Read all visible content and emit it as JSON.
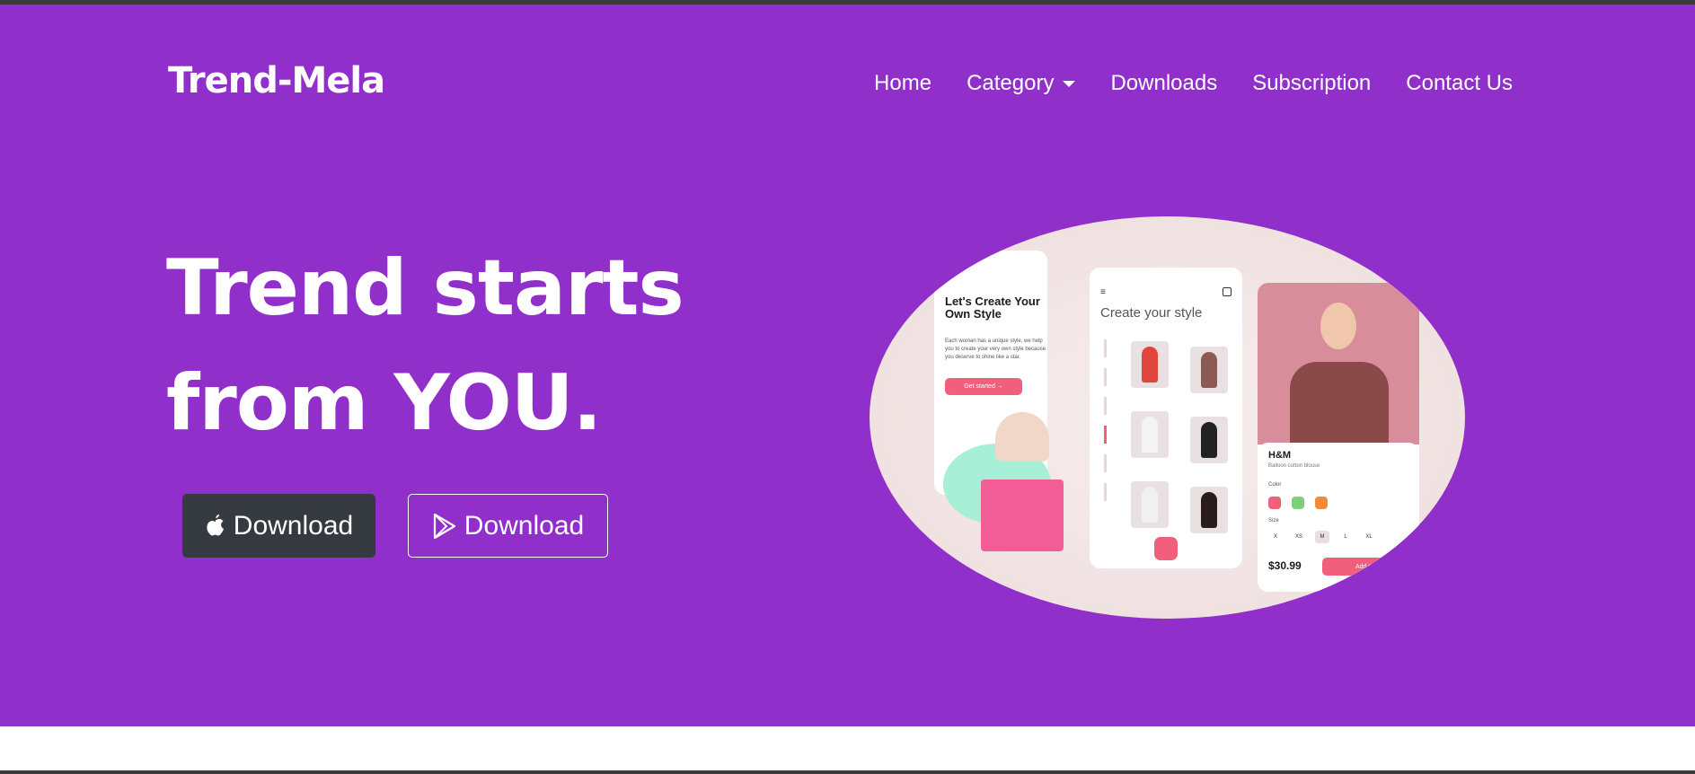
{
  "header": {
    "brand": "Trend-Mela",
    "nav": {
      "home": "Home",
      "category": "Category",
      "downloads": "Downloads",
      "subscription": "Subscription",
      "contact": "Contact Us"
    }
  },
  "hero": {
    "headline_line1": "Trend starts",
    "headline_line2": "from YOU.",
    "apple_button": "Download",
    "play_button": "Download"
  },
  "mockup": {
    "screen1": {
      "title": "Let's Create Your Own Style",
      "body": "Each woman has a unique style, we help you to create your very own style because you deserve to shine like a star.",
      "cta": "Get started"
    },
    "screen2": {
      "title": "Create your style"
    },
    "screen3": {
      "brand": "H&M",
      "product": "Balloon cotton blouse",
      "color_label": "Color",
      "size_label": "Size",
      "sizes": [
        "X",
        "XS",
        "M",
        "L",
        "XL"
      ],
      "price": "$30.99",
      "add_button": "Add to b"
    }
  },
  "colors": {
    "hero_bg": "#912fcb",
    "apple_btn_bg": "#343a40",
    "accent_pink": "#f0607c"
  }
}
